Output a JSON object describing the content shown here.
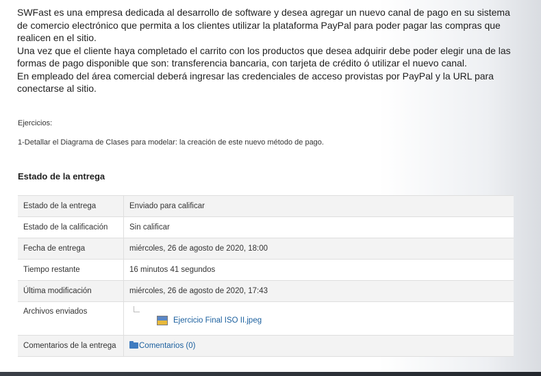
{
  "intro": {
    "p1": "SWFast es una empresa dedicada al desarrollo de software y desea agregar un nuevo canal de pago en su sistema de comercio electrónico que permita a los clientes utilizar la plataforma PayPal para poder pagar las compras que realicen en el sitio.",
    "p2": "Una vez que el cliente haya completado el carrito con los productos que desea adquirir debe poder elegir una de las formas de pago disponible que son: transferencia bancaria, con tarjeta de crédito ó utilizar el nuevo canal.",
    "p3": "En empleado del área comercial deberá ingresar las credenciales de acceso provistas por  PayPal y la URL para conectarse al sitio."
  },
  "exercises": {
    "label": "Ejercicios:",
    "item1": "1-Detallar el Diagrama de Clases para modelar: la creación de este nuevo método de pago."
  },
  "submission": {
    "title": "Estado de la entrega",
    "rows": [
      {
        "key": "Estado de la entrega",
        "value": "Enviado para calificar"
      },
      {
        "key": "Estado de la calificación",
        "value": "Sin calificar"
      },
      {
        "key": "Fecha de entrega",
        "value": "miércoles, 26 de agosto de 2020, 18:00"
      },
      {
        "key": "Tiempo restante",
        "value": "16 minutos 41 segundos"
      },
      {
        "key": "Última modificación",
        "value": "miércoles, 26 de agosto de 2020, 17:43"
      },
      {
        "key": "Archivos enviados",
        "value": "Ejercicio Final ISO II.jpeg"
      },
      {
        "key": "Comentarios de la entrega",
        "value": "Comentarios (0)"
      }
    ]
  },
  "icons": {
    "file": "image-file-icon",
    "folder": "folder-icon"
  }
}
